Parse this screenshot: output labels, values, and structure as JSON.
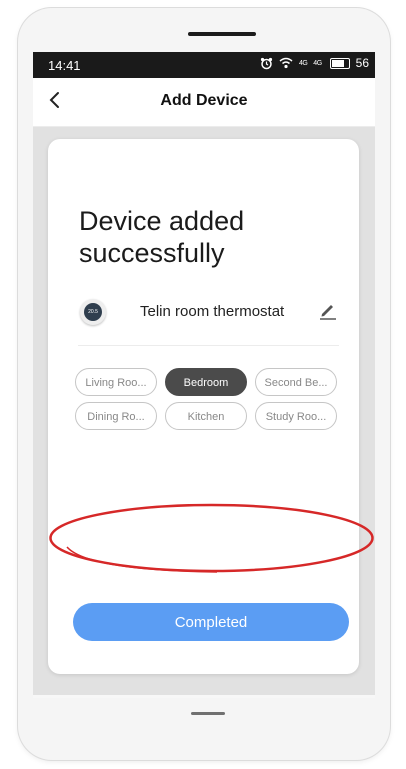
{
  "status_bar": {
    "time": "14:41",
    "signal_1": "4G",
    "signal_2": "4G",
    "battery": "56"
  },
  "nav": {
    "title": "Add Device",
    "back_icon": "chevron-left-icon"
  },
  "card": {
    "headline": "Device added successfully",
    "device": {
      "icon": "thermostat-icon",
      "icon_text": "20.5",
      "name": "Telin room thermostat",
      "edit_icon": "pencil-icon"
    },
    "rooms": [
      {
        "label": "Living Roo...",
        "selected": false
      },
      {
        "label": "Bedroom",
        "selected": true
      },
      {
        "label": "Second Be...",
        "selected": false
      },
      {
        "label": "Dining Ro...",
        "selected": false
      },
      {
        "label": "Kitchen",
        "selected": false
      },
      {
        "label": "Study Roo...",
        "selected": false
      }
    ],
    "completed_label": "Completed"
  },
  "colors": {
    "accent": "#5b9df3",
    "selected_chip": "#4b4b4b",
    "highlight": "#d62828"
  }
}
